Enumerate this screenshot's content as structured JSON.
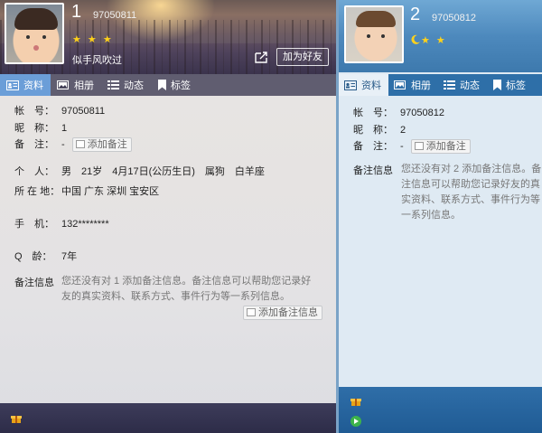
{
  "left": {
    "number": "1",
    "qq_id": "97050811",
    "stars": "★ ★ ★",
    "signature": "似手风吹过",
    "add_friend": "加为好友",
    "tabs": [
      "资料",
      "相册",
      "动态",
      "标签"
    ],
    "profile": {
      "account_label": "帐　号：",
      "account_value": "97050811",
      "nickname_label": "昵　称：",
      "nickname_value": "1",
      "remark_label": "备　注：",
      "remark_value": "-",
      "add_remark_btn": "添加备注",
      "personal_label": "个　人：",
      "personal_value": "男　21岁　4月17日(公历生日)　属狗　白羊座",
      "location_label": "所 在 地：",
      "location_value": "中国 广东 深圳 宝安区",
      "phone_label": "手　机：",
      "phone_value": "132********",
      "qage_label": "Q　龄：",
      "qage_value": "7年",
      "remark_info_label": "备注信息",
      "remark_info_text": "您还没有对 1 添加备注信息。备注信息可以帮助您记录好友的真实资料、联系方式、事件行为等一系列信息。",
      "add_remark_info_btn": "添加备注信息"
    }
  },
  "right": {
    "number": "2",
    "qq_id": "97050812",
    "tabs": [
      "资料",
      "相册",
      "动态",
      "标签"
    ],
    "profile": {
      "account_label": "帐　号：",
      "account_value": "97050812",
      "nickname_label": "昵　称：",
      "nickname_value": "2",
      "remark_label": "备　注：",
      "remark_value": "-",
      "add_remark_btn": "添加备注",
      "remark_info_label": "备注信息",
      "remark_info_text": "您还没有对 2 添加备注信息。备注信息可以帮助您记录好友的真实资料、联系方式、事件行为等一系列信息。"
    }
  },
  "icons": {
    "share": "share-icon",
    "tab_profile": "id-card-icon",
    "tab_album": "photo-icon",
    "tab_feed": "list-icon",
    "tab_tag": "bookmark-icon",
    "level_moon": "moon-icon",
    "footer_gift": "gift-icon",
    "footer_play": "play-icon"
  },
  "colors": {
    "left_tab_active": "#6b9ed8",
    "right_header": "#4d89bd",
    "star": "#ffd21a"
  }
}
